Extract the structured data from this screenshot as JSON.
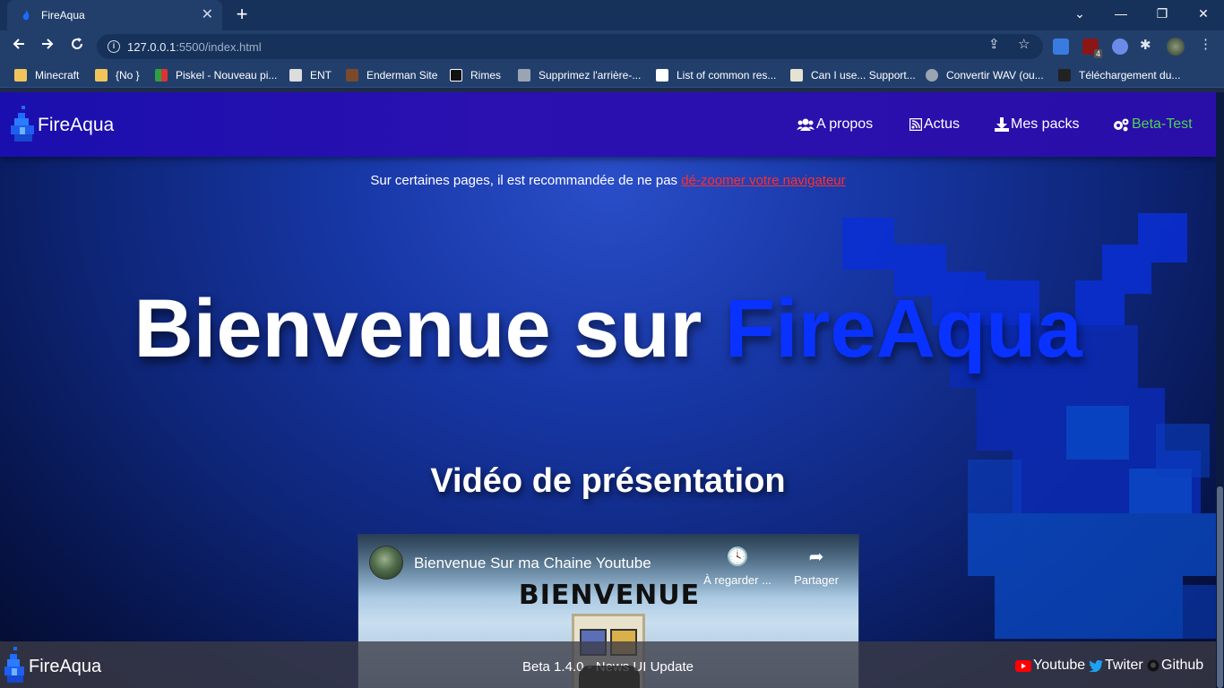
{
  "browser": {
    "tab_title": "FireAqua",
    "tab_close": "✕",
    "new_tab": "+",
    "url_host": "127.0.0.1",
    "url_path": ":5500/index.html",
    "window_controls": {
      "minimize": "—",
      "restore": "❐",
      "close": "✕",
      "tabs_menu": "⌄"
    },
    "bookmarks": [
      {
        "label": "Minecraft",
        "icon": "folder-icon"
      },
      {
        "label": "{No }",
        "icon": "folder-icon"
      },
      {
        "label": "Piskel - Nouveau pi...",
        "icon": "piskel-icon"
      },
      {
        "label": "ENT",
        "icon": "ent-icon"
      },
      {
        "label": "Enderman Site",
        "icon": "enderman-icon"
      },
      {
        "label": "Rimes",
        "icon": "rimes-icon"
      },
      {
        "label": "Supprimez l'arrière-...",
        "icon": "remove-bg-icon"
      },
      {
        "label": "List of common res...",
        "icon": "wikipedia-icon"
      },
      {
        "label": "Can I use... Support...",
        "icon": "caniuse-icon"
      },
      {
        "label": "Convertir WAV (ou...",
        "icon": "convert-icon"
      },
      {
        "label": "Téléchargement du...",
        "icon": "download-site-icon"
      }
    ],
    "extension_badge": "4"
  },
  "site": {
    "brand": "FireAqua",
    "nav": [
      {
        "label": "A propos",
        "icon": "users-icon"
      },
      {
        "label": "Actus",
        "icon": "rss-icon"
      },
      {
        "label": "Mes packs",
        "icon": "download-icon"
      },
      {
        "label": "Beta-Test",
        "icon": "cogs-icon"
      }
    ],
    "notice_text": "Sur certaines pages, il est recommandée de ne pas ",
    "notice_link": "dé-zoomer votre navigateur",
    "hero_prefix": "Bienvenue sur ",
    "hero_accent": "FireAqua",
    "video_heading": "Vidéo de présentation",
    "video": {
      "title": "Bienvenue Sur ma Chaine Youtube",
      "watch_later": "À regarder ...",
      "share": "Partager",
      "thumbnail_text": "BIENVENUE"
    },
    "footer": {
      "brand": "FireAqua",
      "version": "Beta 1.4.0 - News UI Update",
      "links": [
        {
          "label": "Youtube",
          "icon": "youtube-icon"
        },
        {
          "label": "Twiter",
          "icon": "twitter-icon"
        },
        {
          "label": "Github",
          "icon": "github-icon"
        }
      ]
    }
  },
  "colors": {
    "accent_blue": "#0a32ff",
    "beta_green": "#4dd64d",
    "link_red": "#ff2d2d",
    "nav_bg": "#2a11b0"
  }
}
